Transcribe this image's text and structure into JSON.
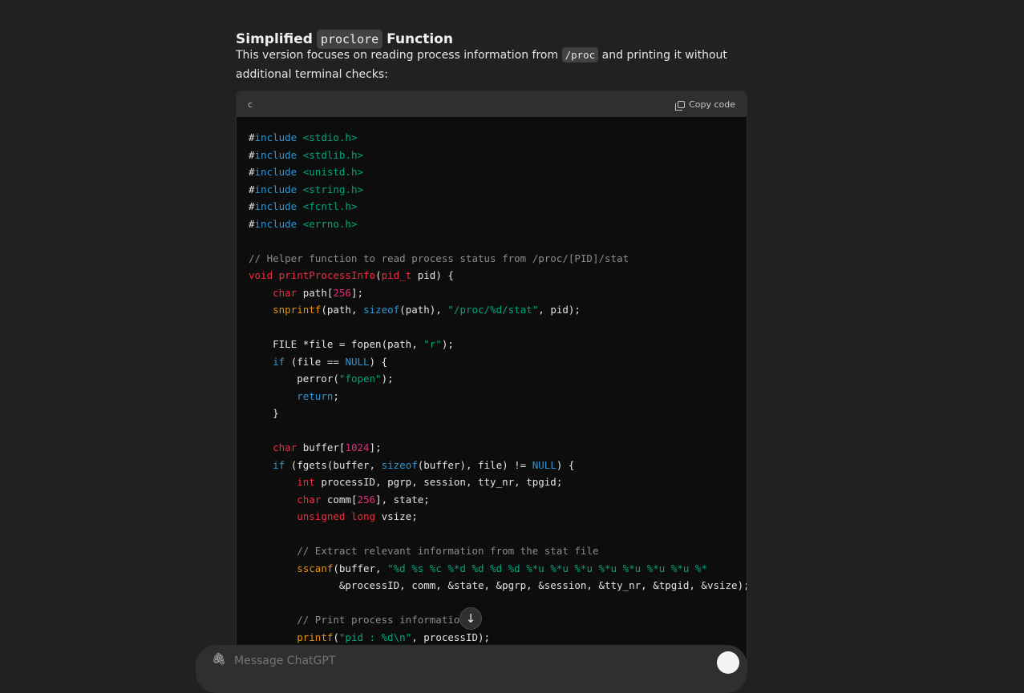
{
  "section": {
    "heading_pre": "Simplified",
    "heading_code": "proclore",
    "heading_post": "Function",
    "para_pre": "This version focuses on reading process information from",
    "para_code": "/proc",
    "para_post": "and printing it without additional terminal checks:"
  },
  "codeblock": {
    "language": "c",
    "copy_label": "Copy code"
  },
  "composer": {
    "placeholder": "Message ChatGPT"
  },
  "icons": {
    "scroll_down": "arrow-down-icon",
    "copy": "copy-icon",
    "attach": "paperclip-icon",
    "send": "send-icon"
  },
  "colors": {
    "background": "#212121",
    "code_bg": "#0d0d0d",
    "keyword": "#2e95d3",
    "type": "#f22c3d",
    "string": "#00a67d",
    "number": "#df3079",
    "call": "#e9950c",
    "comment": "#8c8c8c"
  }
}
